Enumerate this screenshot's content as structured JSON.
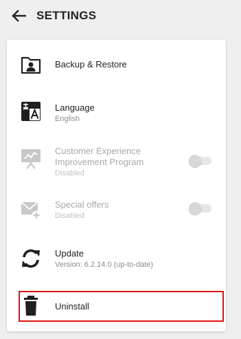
{
  "header": {
    "title": "SETTINGS",
    "back_icon": "arrow-left-icon"
  },
  "items": [
    {
      "title": "Backup & Restore",
      "icon": "backup-restore-icon"
    },
    {
      "title": "Language",
      "subtitle": "English",
      "icon": "language-icon"
    },
    {
      "title": "Customer Experience Improvement Program",
      "subtitle": "Disabled",
      "icon": "presentation-chart-icon",
      "toggle": false,
      "enabled": false
    },
    {
      "title": "Special offers",
      "subtitle": "Disabled",
      "icon": "mail-plus-icon",
      "toggle": false,
      "enabled": false
    },
    {
      "title": "Update",
      "subtitle": "Version: 6.2.14.0 (up-to-date)",
      "icon": "sync-icon"
    },
    {
      "title": "Uninstall",
      "icon": "trash-icon",
      "highlighted": true
    }
  ],
  "colors": {
    "background": "#efefef",
    "card": "#ffffff",
    "highlight_border": "#e01010",
    "icon_active": "#1f1f1f",
    "icon_disabled": "#c8c8c8"
  }
}
